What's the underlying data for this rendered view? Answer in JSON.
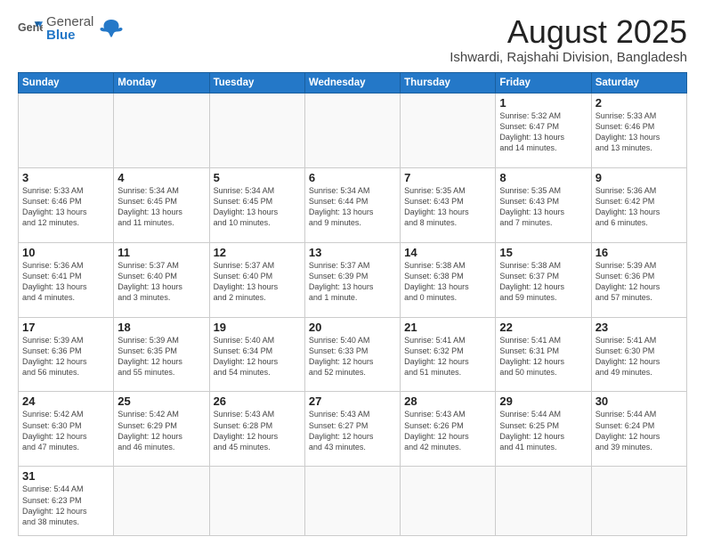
{
  "logo": {
    "text_general": "General",
    "text_blue": "Blue"
  },
  "header": {
    "month_year": "August 2025",
    "location": "Ishwardi, Rajshahi Division, Bangladesh"
  },
  "weekdays": [
    "Sunday",
    "Monday",
    "Tuesday",
    "Wednesday",
    "Thursday",
    "Friday",
    "Saturday"
  ],
  "weeks": [
    [
      {
        "day": "",
        "info": ""
      },
      {
        "day": "",
        "info": ""
      },
      {
        "day": "",
        "info": ""
      },
      {
        "day": "",
        "info": ""
      },
      {
        "day": "",
        "info": ""
      },
      {
        "day": "1",
        "info": "Sunrise: 5:32 AM\nSunset: 6:47 PM\nDaylight: 13 hours\nand 14 minutes."
      },
      {
        "day": "2",
        "info": "Sunrise: 5:33 AM\nSunset: 6:46 PM\nDaylight: 13 hours\nand 13 minutes."
      }
    ],
    [
      {
        "day": "3",
        "info": "Sunrise: 5:33 AM\nSunset: 6:46 PM\nDaylight: 13 hours\nand 12 minutes."
      },
      {
        "day": "4",
        "info": "Sunrise: 5:34 AM\nSunset: 6:45 PM\nDaylight: 13 hours\nand 11 minutes."
      },
      {
        "day": "5",
        "info": "Sunrise: 5:34 AM\nSunset: 6:45 PM\nDaylight: 13 hours\nand 10 minutes."
      },
      {
        "day": "6",
        "info": "Sunrise: 5:34 AM\nSunset: 6:44 PM\nDaylight: 13 hours\nand 9 minutes."
      },
      {
        "day": "7",
        "info": "Sunrise: 5:35 AM\nSunset: 6:43 PM\nDaylight: 13 hours\nand 8 minutes."
      },
      {
        "day": "8",
        "info": "Sunrise: 5:35 AM\nSunset: 6:43 PM\nDaylight: 13 hours\nand 7 minutes."
      },
      {
        "day": "9",
        "info": "Sunrise: 5:36 AM\nSunset: 6:42 PM\nDaylight: 13 hours\nand 6 minutes."
      }
    ],
    [
      {
        "day": "10",
        "info": "Sunrise: 5:36 AM\nSunset: 6:41 PM\nDaylight: 13 hours\nand 4 minutes."
      },
      {
        "day": "11",
        "info": "Sunrise: 5:37 AM\nSunset: 6:40 PM\nDaylight: 13 hours\nand 3 minutes."
      },
      {
        "day": "12",
        "info": "Sunrise: 5:37 AM\nSunset: 6:40 PM\nDaylight: 13 hours\nand 2 minutes."
      },
      {
        "day": "13",
        "info": "Sunrise: 5:37 AM\nSunset: 6:39 PM\nDaylight: 13 hours\nand 1 minute."
      },
      {
        "day": "14",
        "info": "Sunrise: 5:38 AM\nSunset: 6:38 PM\nDaylight: 13 hours\nand 0 minutes."
      },
      {
        "day": "15",
        "info": "Sunrise: 5:38 AM\nSunset: 6:37 PM\nDaylight: 12 hours\nand 59 minutes."
      },
      {
        "day": "16",
        "info": "Sunrise: 5:39 AM\nSunset: 6:36 PM\nDaylight: 12 hours\nand 57 minutes."
      }
    ],
    [
      {
        "day": "17",
        "info": "Sunrise: 5:39 AM\nSunset: 6:36 PM\nDaylight: 12 hours\nand 56 minutes."
      },
      {
        "day": "18",
        "info": "Sunrise: 5:39 AM\nSunset: 6:35 PM\nDaylight: 12 hours\nand 55 minutes."
      },
      {
        "day": "19",
        "info": "Sunrise: 5:40 AM\nSunset: 6:34 PM\nDaylight: 12 hours\nand 54 minutes."
      },
      {
        "day": "20",
        "info": "Sunrise: 5:40 AM\nSunset: 6:33 PM\nDaylight: 12 hours\nand 52 minutes."
      },
      {
        "day": "21",
        "info": "Sunrise: 5:41 AM\nSunset: 6:32 PM\nDaylight: 12 hours\nand 51 minutes."
      },
      {
        "day": "22",
        "info": "Sunrise: 5:41 AM\nSunset: 6:31 PM\nDaylight: 12 hours\nand 50 minutes."
      },
      {
        "day": "23",
        "info": "Sunrise: 5:41 AM\nSunset: 6:30 PM\nDaylight: 12 hours\nand 49 minutes."
      }
    ],
    [
      {
        "day": "24",
        "info": "Sunrise: 5:42 AM\nSunset: 6:30 PM\nDaylight: 12 hours\nand 47 minutes."
      },
      {
        "day": "25",
        "info": "Sunrise: 5:42 AM\nSunset: 6:29 PM\nDaylight: 12 hours\nand 46 minutes."
      },
      {
        "day": "26",
        "info": "Sunrise: 5:43 AM\nSunset: 6:28 PM\nDaylight: 12 hours\nand 45 minutes."
      },
      {
        "day": "27",
        "info": "Sunrise: 5:43 AM\nSunset: 6:27 PM\nDaylight: 12 hours\nand 43 minutes."
      },
      {
        "day": "28",
        "info": "Sunrise: 5:43 AM\nSunset: 6:26 PM\nDaylight: 12 hours\nand 42 minutes."
      },
      {
        "day": "29",
        "info": "Sunrise: 5:44 AM\nSunset: 6:25 PM\nDaylight: 12 hours\nand 41 minutes."
      },
      {
        "day": "30",
        "info": "Sunrise: 5:44 AM\nSunset: 6:24 PM\nDaylight: 12 hours\nand 39 minutes."
      }
    ],
    [
      {
        "day": "31",
        "info": "Sunrise: 5:44 AM\nSunset: 6:23 PM\nDaylight: 12 hours\nand 38 minutes."
      },
      {
        "day": "",
        "info": ""
      },
      {
        "day": "",
        "info": ""
      },
      {
        "day": "",
        "info": ""
      },
      {
        "day": "",
        "info": ""
      },
      {
        "day": "",
        "info": ""
      },
      {
        "day": "",
        "info": ""
      }
    ]
  ]
}
